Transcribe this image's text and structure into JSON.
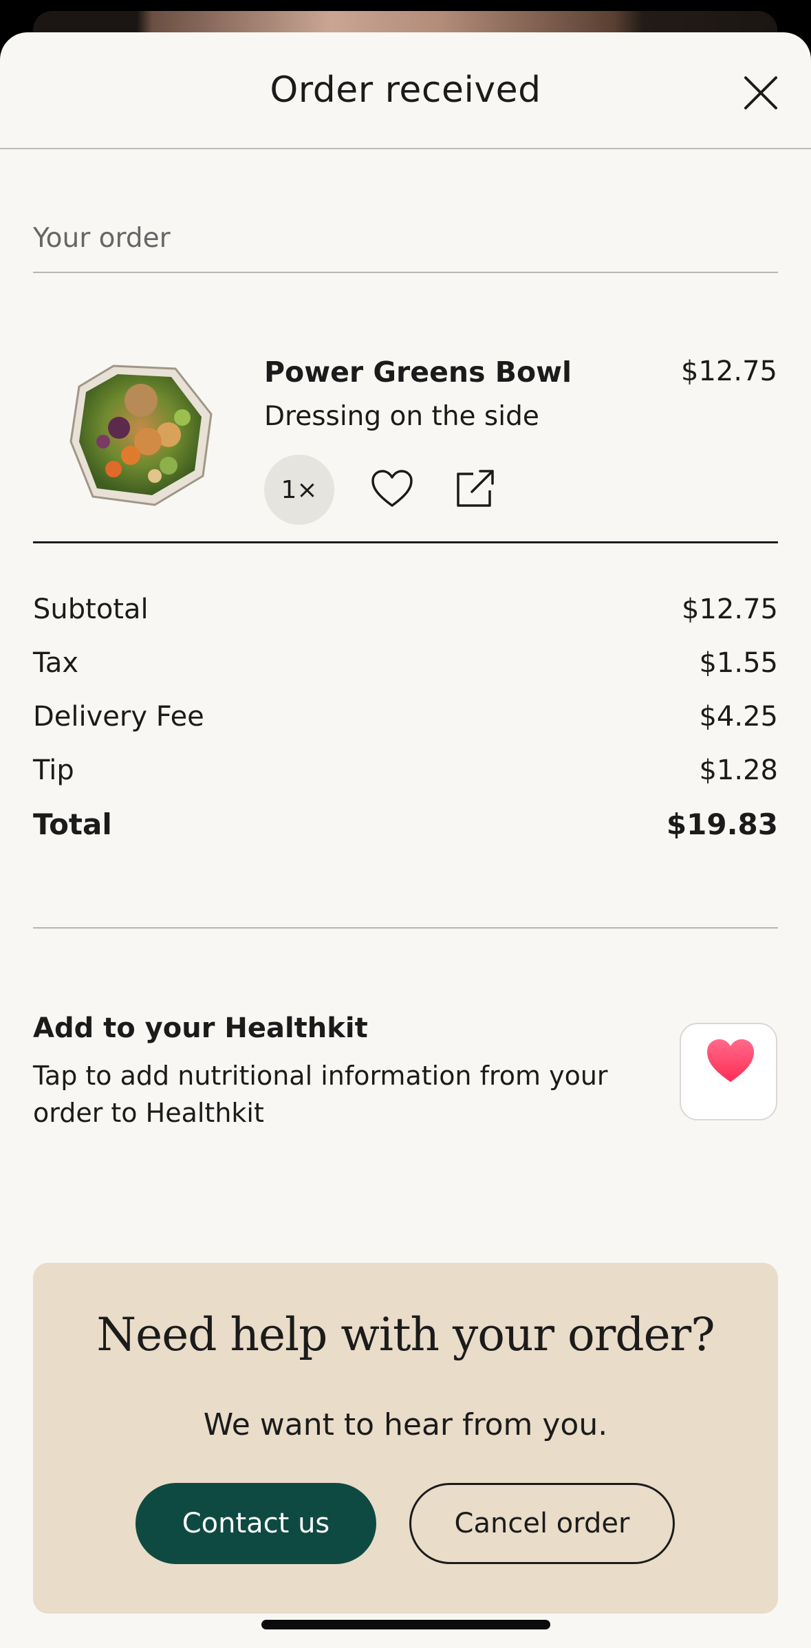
{
  "header": {
    "title": "Order received"
  },
  "order": {
    "section_label": "Your order",
    "item": {
      "name": "Power Greens Bowl",
      "price": "$12.75",
      "modifier": "Dressing on the side",
      "quantity": "1×"
    }
  },
  "summary": {
    "rows": [
      {
        "label": "Subtotal",
        "value": "$12.75"
      },
      {
        "label": "Tax",
        "value": "$1.55"
      },
      {
        "label": "Delivery Fee",
        "value": "$4.25"
      },
      {
        "label": "Tip",
        "value": "$1.28"
      }
    ],
    "total": {
      "label": "Total",
      "value": "$19.83"
    }
  },
  "healthkit": {
    "title": "Add to your Healthkit",
    "description": "Tap to add nutritional information from your order to Healthkit",
    "icon": "heart-icon",
    "heart_color": "#ff2d55"
  },
  "help": {
    "title": "Need help with your order?",
    "subtitle": "We want to hear from you.",
    "contact_label": "Contact us",
    "cancel_label": "Cancel order"
  },
  "colors": {
    "background": "#f8f7f3",
    "accent": "#0e4a42",
    "help_card": "#e9dcc8"
  }
}
